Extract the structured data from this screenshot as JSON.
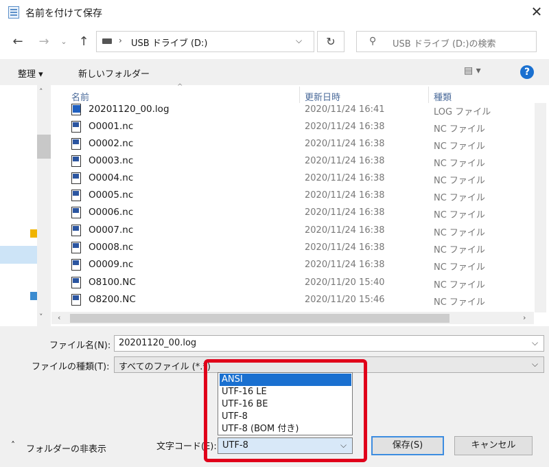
{
  "window": {
    "title": "名前を付けて保存",
    "close_icon": "✕"
  },
  "nav": {
    "back_icon": "back-arrow-icon",
    "forward_icon": "forward-arrow-icon",
    "up_icon": "up-arrow-icon",
    "address_path": "USB ドライブ (D:)",
    "search_placeholder": "USB ドライブ (D:)の検索"
  },
  "toolbar": {
    "organize_label": "整理 ▾",
    "new_folder_label": "新しいフォルダー",
    "help_label": "?"
  },
  "columns": {
    "name": "名前",
    "date": "更新日時",
    "type": "種類"
  },
  "files": [
    {
      "name": "20201120_00.log",
      "date": "2020/11/24 16:41",
      "type": "LOG ファイル",
      "icon": "log"
    },
    {
      "name": "O0001.nc",
      "date": "2020/11/24 16:38",
      "type": "NC ファイル",
      "icon": "nc"
    },
    {
      "name": "O0002.nc",
      "date": "2020/11/24 16:38",
      "type": "NC ファイル",
      "icon": "nc"
    },
    {
      "name": "O0003.nc",
      "date": "2020/11/24 16:38",
      "type": "NC ファイル",
      "icon": "nc"
    },
    {
      "name": "O0004.nc",
      "date": "2020/11/24 16:38",
      "type": "NC ファイル",
      "icon": "nc"
    },
    {
      "name": "O0005.nc",
      "date": "2020/11/24 16:38",
      "type": "NC ファイル",
      "icon": "nc"
    },
    {
      "name": "O0006.nc",
      "date": "2020/11/24 16:38",
      "type": "NC ファイル",
      "icon": "nc"
    },
    {
      "name": "O0007.nc",
      "date": "2020/11/24 16:38",
      "type": "NC ファイル",
      "icon": "nc"
    },
    {
      "name": "O0008.nc",
      "date": "2020/11/24 16:38",
      "type": "NC ファイル",
      "icon": "nc"
    },
    {
      "name": "O0009.nc",
      "date": "2020/11/24 16:38",
      "type": "NC ファイル",
      "icon": "nc"
    },
    {
      "name": "O8100.NC",
      "date": "2020/11/20 15:40",
      "type": "NC ファイル",
      "icon": "nc"
    },
    {
      "name": "O8200.NC",
      "date": "2020/11/20 15:46",
      "type": "NC ファイル",
      "icon": "nc"
    }
  ],
  "form": {
    "filename_label": "ファイル名(N):",
    "filename_value": "20201120_00.log",
    "filetype_label": "ファイルの種類(T):",
    "filetype_value": "すべてのファイル (*.*)",
    "encoding_label": "文字コード(E):",
    "encoding_value": "UTF-8",
    "encoding_options": [
      "ANSI",
      "UTF-16 LE",
      "UTF-16 BE",
      "UTF-8",
      "UTF-8 (BOM 付き)"
    ],
    "hide_folders_label": "フォルダーの非表示",
    "save_label": "保存(S)",
    "cancel_label": "キャンセル"
  },
  "highlight_color": "#e0001a",
  "selection_color": "#1a70d0"
}
